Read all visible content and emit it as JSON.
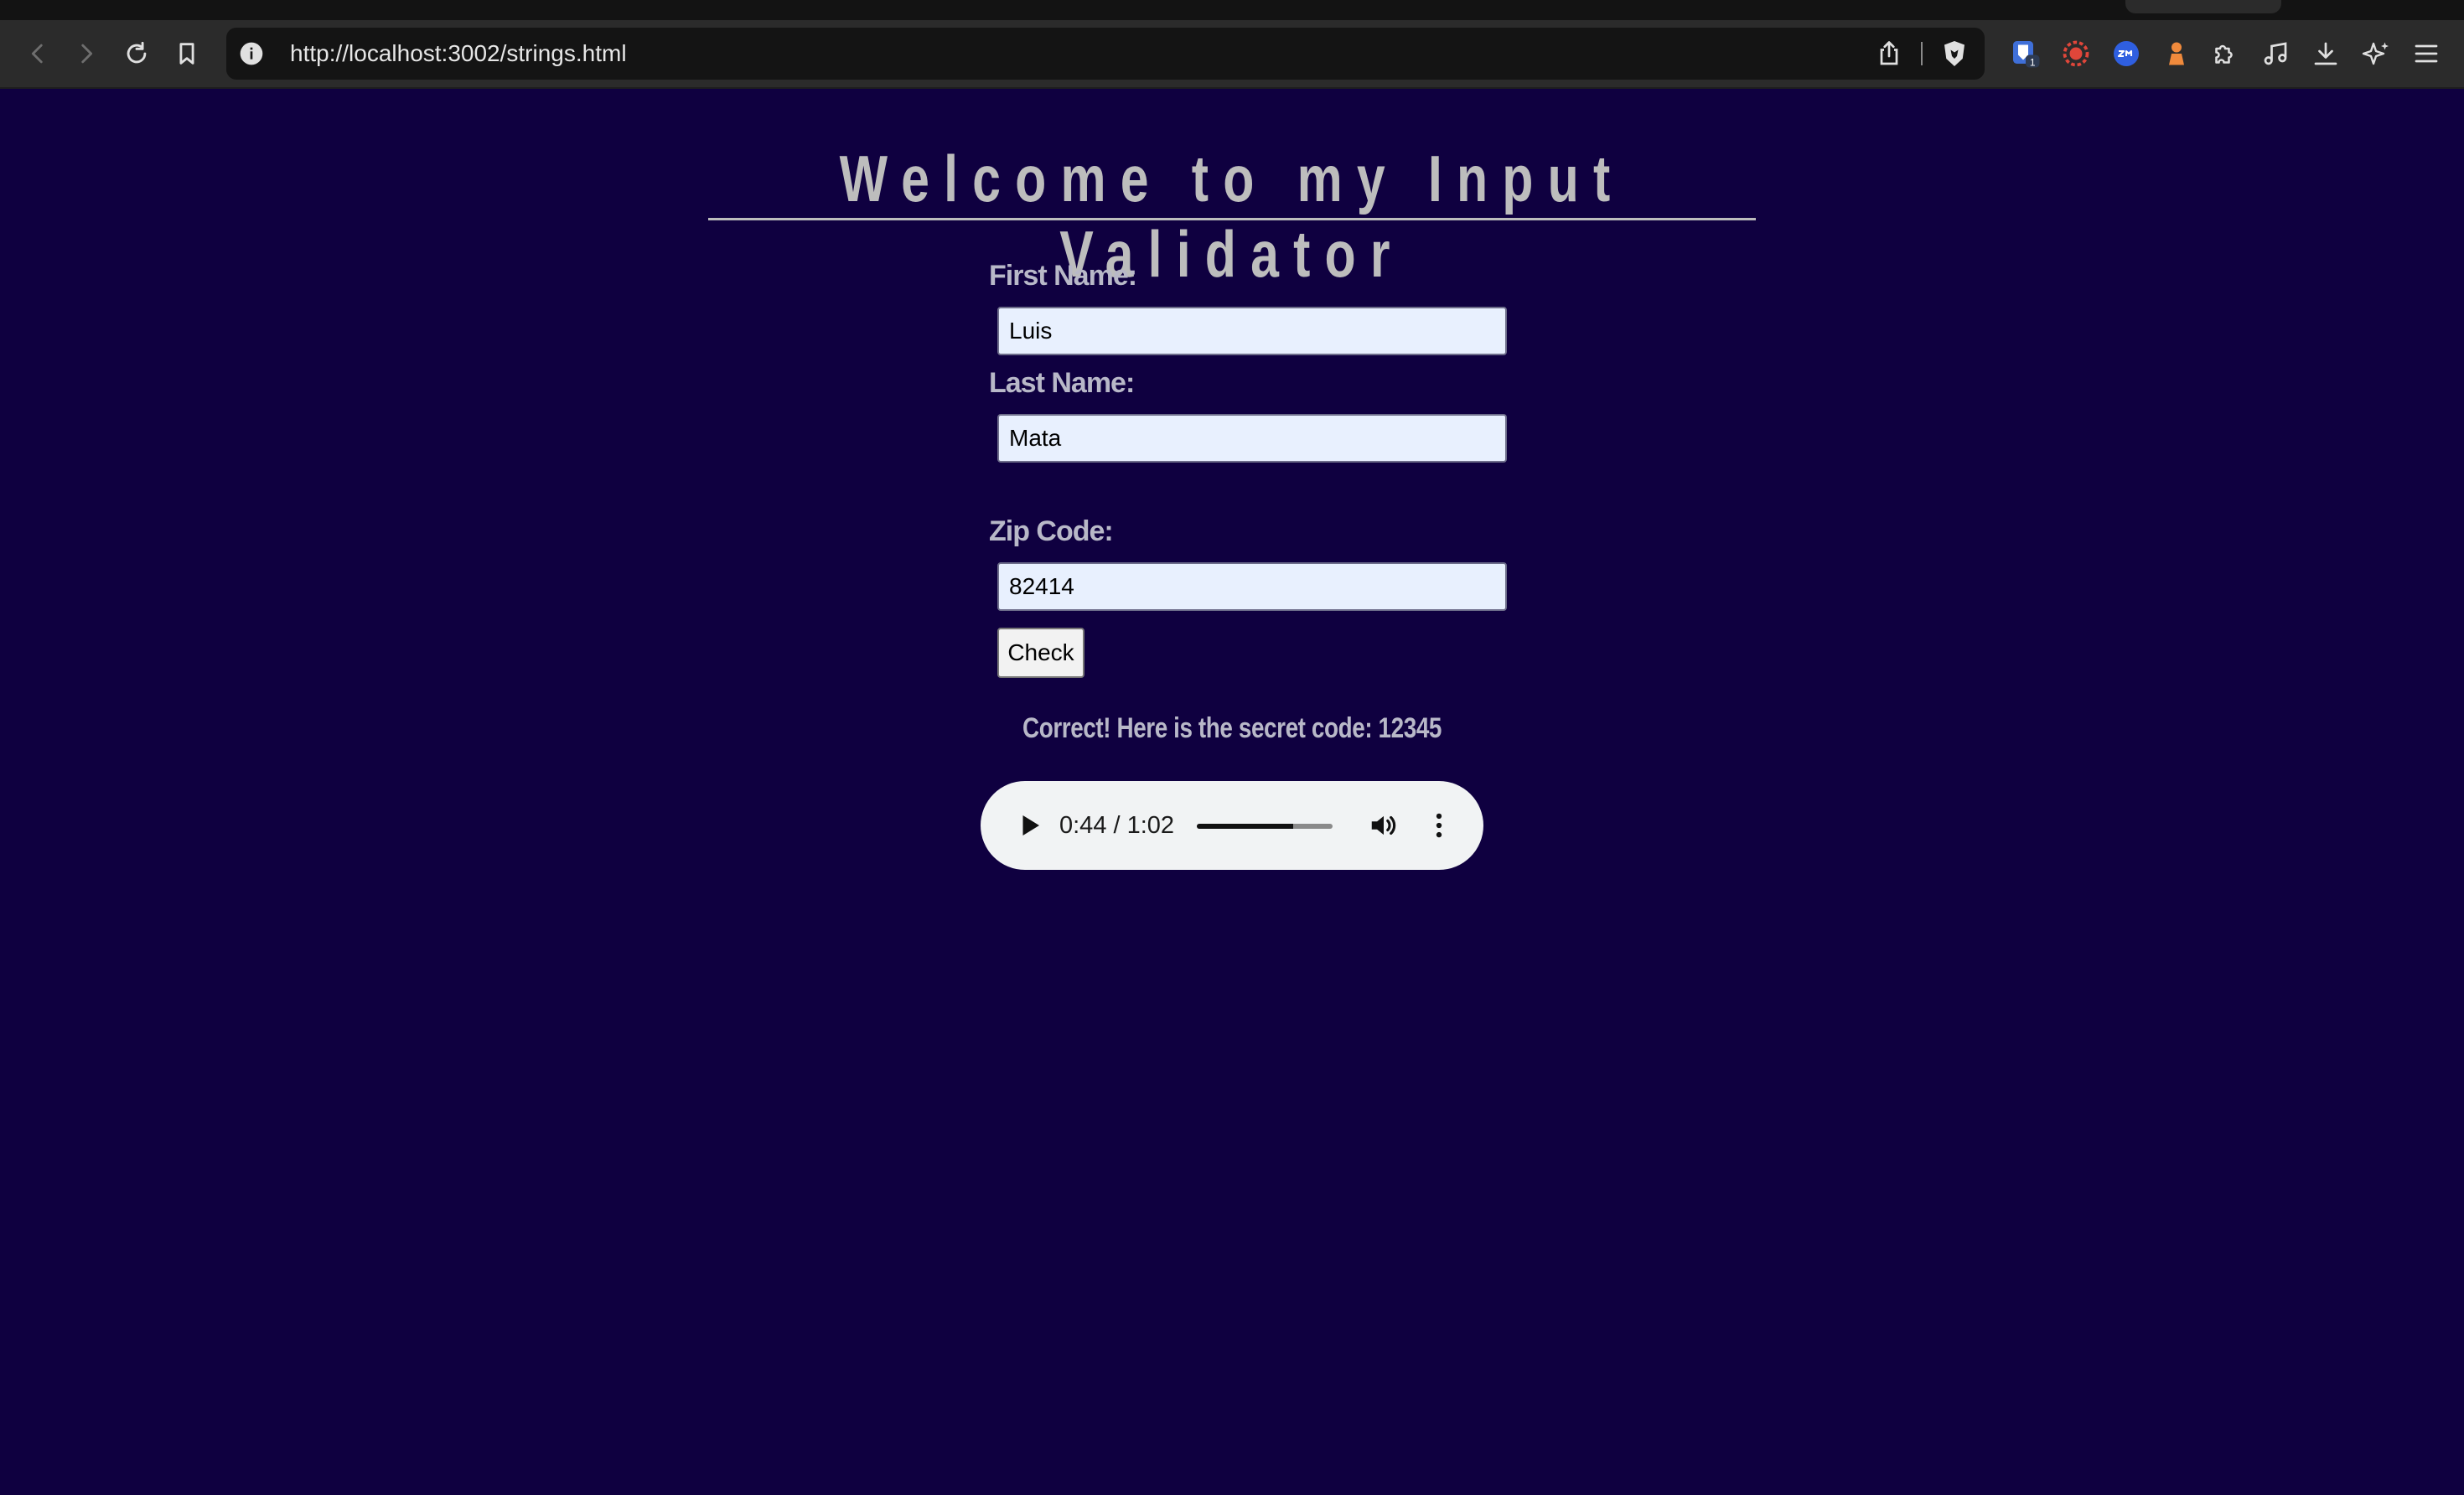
{
  "browser": {
    "url": "http://localhost:3002/strings.html",
    "extension_badge": "1"
  },
  "page": {
    "title": "Welcome to my Input Validator",
    "first_name_label": "First Name:",
    "first_name_value": "Luis",
    "last_name_label": "Last Name:",
    "last_name_value": "Mata",
    "zip_label": "Zip Code:",
    "zip_value": "82414",
    "check_label": "Check",
    "result": "Correct! Here is the secret code: 12345"
  },
  "audio": {
    "time": "0:44 / 1:02",
    "progress_fraction": 0.71
  },
  "colors": {
    "page_background": "#0f0040",
    "text": "#bdbdbd",
    "input_background": "#e8f0fe"
  }
}
